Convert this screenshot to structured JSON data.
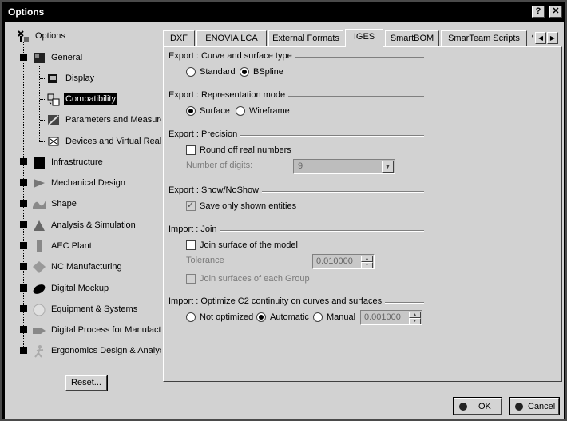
{
  "window": {
    "title": "Options"
  },
  "titlebar_buttons": {
    "help": "?",
    "close": "✕"
  },
  "tree": {
    "root": "Options",
    "items": [
      {
        "label": "General",
        "icon": "general-icon"
      },
      {
        "label": "Display",
        "icon": "display-icon"
      },
      {
        "label": "Compatibility",
        "icon": "compatibility-icon",
        "selected": true
      },
      {
        "label": "Parameters and Measure",
        "icon": "parameters-icon"
      },
      {
        "label": "Devices and Virtual Realit",
        "icon": "devices-icon"
      },
      {
        "label": "Infrastructure",
        "icon": "infrastructure-icon"
      },
      {
        "label": "Mechanical Design",
        "icon": "mechanical-design-icon"
      },
      {
        "label": "Shape",
        "icon": "shape-icon"
      },
      {
        "label": "Analysis & Simulation",
        "icon": "analysis-icon"
      },
      {
        "label": "AEC Plant",
        "icon": "aec-plant-icon"
      },
      {
        "label": "NC Manufacturing",
        "icon": "nc-manufacturing-icon"
      },
      {
        "label": "Digital Mockup",
        "icon": "digital-mockup-icon"
      },
      {
        "label": "Equipment & Systems",
        "icon": "equipment-icon"
      },
      {
        "label": "Digital Process for Manufactu",
        "icon": "digital-process-icon"
      },
      {
        "label": "Ergonomics Design & Analysi",
        "icon": "ergonomics-icon"
      }
    ]
  },
  "reset_label": "Reset...",
  "tabs": [
    {
      "label": "DXF"
    },
    {
      "label": "ENOVIA LCA"
    },
    {
      "label": "External Formats"
    },
    {
      "label": "IGES",
      "active": true
    },
    {
      "label": "SmartBOM"
    },
    {
      "label": "SmarTeam Scripts"
    }
  ],
  "tab_overflow_glyph": "〈",
  "tab_scroll": {
    "left": "◀",
    "right": "▶"
  },
  "sections": {
    "curve": {
      "title": "Export : Curve and surface type",
      "options": [
        "Standard",
        "BSpline"
      ],
      "selected": "BSpline"
    },
    "representation": {
      "title": "Export : Representation mode",
      "options": [
        "Surface",
        "Wireframe"
      ],
      "selected": "Surface"
    },
    "precision": {
      "title": "Export : Precision",
      "round_off_label": "Round off real numbers",
      "round_off_checked": false,
      "digits_label": "Number of digits:",
      "digits_value": "9",
      "dropdown_glyph": "▼"
    },
    "shownoshow": {
      "title": "Export : Show/NoShow",
      "save_label": "Save only shown entities",
      "save_checked": true
    },
    "join": {
      "title": "Import : Join",
      "join_model_label": "Join surface of the model",
      "join_model_checked": false,
      "tolerance_label": "Tolerance",
      "tolerance_value": "0.010000",
      "join_group_label": "Join surfaces of each Group",
      "join_group_checked": false
    },
    "optimize": {
      "title": "Import : Optimize C2 continuity on curves and surfaces",
      "options": [
        "Not optimized",
        "Automatic",
        "Manual"
      ],
      "selected": "Automatic",
      "manual_value": "0.001000"
    }
  },
  "spinner_glyphs": {
    "up": "▲",
    "down": "▼"
  },
  "buttons": {
    "ok": "OK",
    "cancel": "Cancel"
  }
}
